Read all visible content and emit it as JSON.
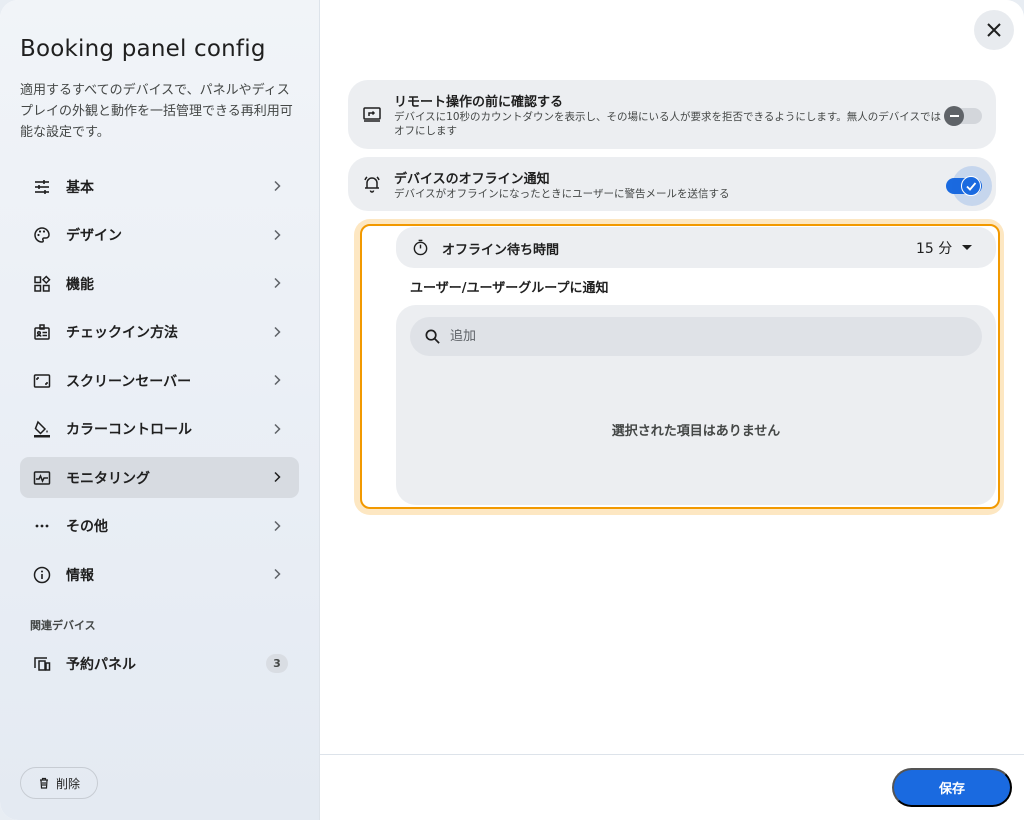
{
  "sidebar": {
    "title": "Booking panel config",
    "description": "適用するすべてのデバイスで、パネルやディスプレイの外観と動作を一括管理できる再利用可能な設定です。",
    "items": [
      {
        "label": "基本",
        "icon": "tune-icon"
      },
      {
        "label": "デザイン",
        "icon": "palette-icon"
      },
      {
        "label": "機能",
        "icon": "widgets-icon"
      },
      {
        "label": "チェックイン方法",
        "icon": "badge-icon"
      },
      {
        "label": "スクリーンセーバー",
        "icon": "screensaver-icon"
      },
      {
        "label": "カラーコントロール",
        "icon": "format-color-fill-icon"
      },
      {
        "label": "モニタリング",
        "icon": "monitoring-icon",
        "active": true
      },
      {
        "label": "その他",
        "icon": "more-horiz-icon"
      },
      {
        "label": "情報",
        "icon": "info-icon"
      }
    ],
    "section_label": "関連デバイス",
    "devices": [
      {
        "label": "予約パネル",
        "count": "3",
        "icon": "devices-icon"
      }
    ],
    "delete_label": "削除"
  },
  "main": {
    "settings": [
      {
        "title": "リモート操作の前に確認する",
        "description": "デバイスに10秒のカウントダウンを表示し、その場にいる人が要求を拒否できるようにします。無人のデバイスではオフにします",
        "enabled": false,
        "icon": "remote-screen-icon"
      },
      {
        "title": "デバイスのオフライン通知",
        "description": "デバイスがオフラインになったときにユーザーに警告メールを送信する",
        "enabled": true,
        "icon": "notifications-icon"
      }
    ],
    "offline_wait": {
      "label": "オフライン待ち時間",
      "value": "15 分"
    },
    "notify_label": "ユーザー/ユーザーグループに通知",
    "search_placeholder": "追加",
    "empty_text": "選択された項目はありません",
    "save_label": "保存"
  },
  "colors": {
    "accent": "#1a6ae0",
    "highlight": "#f29900"
  }
}
